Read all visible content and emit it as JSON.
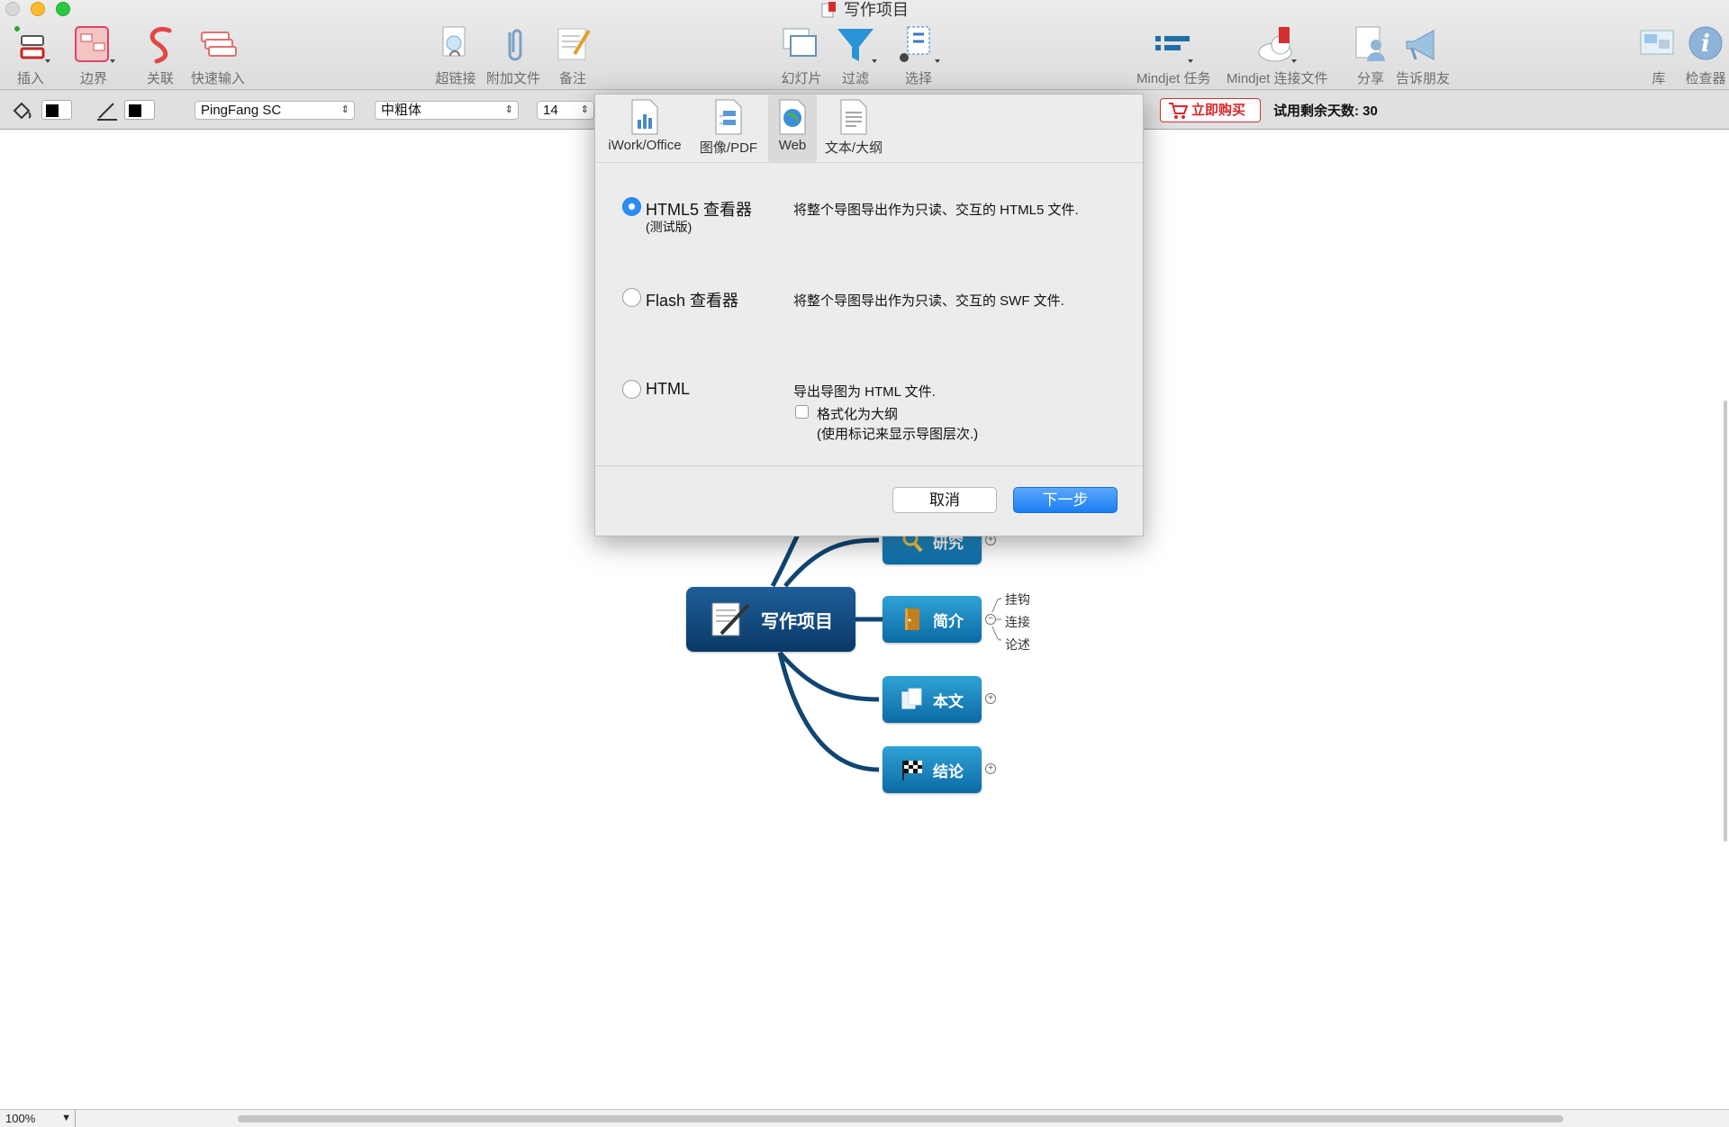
{
  "window": {
    "title": "写作项目"
  },
  "toolbar": {
    "insert": "插入",
    "boundary": "边界",
    "relationship": "关联",
    "quick_entry": "快速输入",
    "hyperlink": "超链接",
    "attachment": "附加文件",
    "notes": "备注",
    "slides": "幻灯片",
    "filter": "过滤",
    "select": "选择",
    "mindjet_tasks": "Mindjet 任务",
    "mindjet_connect": "Mindjet 连接文件",
    "share": "分享",
    "tell_friends": "告诉朋友",
    "library": "库",
    "inspector": "检查器"
  },
  "formatbar": {
    "font_family": "PingFang SC",
    "font_weight": "中粗体",
    "font_size": "14",
    "buy_now": "立即购买",
    "trial_days": "试用剩余天数: 30"
  },
  "export_dialog": {
    "tabs": [
      {
        "label": "iWork/Office"
      },
      {
        "label": "图像/PDF"
      },
      {
        "label": "Web"
      },
      {
        "label": "文本/大纲"
      }
    ],
    "selected_tab": "Web",
    "options": [
      {
        "label": "HTML5 查看器",
        "sublabel": "(测试版)",
        "description": "将整个导图导出作为只读、交互的 HTML5 文件.",
        "selected": true
      },
      {
        "label": "Flash 查看器",
        "description": "将整个导图导出作为只读、交互的 SWF 文件.",
        "selected": false
      },
      {
        "label": "HTML",
        "description": "导出导图为 HTML 文件.",
        "selected": false
      }
    ],
    "outline_checkbox": {
      "label": "格式化为大纲",
      "note": "(使用标记来显示导图层次.)",
      "checked": false
    },
    "cancel": "取消",
    "next": "下一步"
  },
  "mindmap": {
    "central": "写作项目",
    "branches": [
      {
        "label": "研究"
      },
      {
        "label": "简介"
      },
      {
        "label": "本文"
      },
      {
        "label": "结论"
      }
    ],
    "intro_subtopics": [
      "挂钩",
      "连接",
      "论述"
    ]
  },
  "status": {
    "zoom": "100%"
  },
  "colors": {
    "accent": "#2a8cf5",
    "node_blue": "#1a7fbf",
    "central": "#0f4d85",
    "buy_red": "#d8262c"
  }
}
